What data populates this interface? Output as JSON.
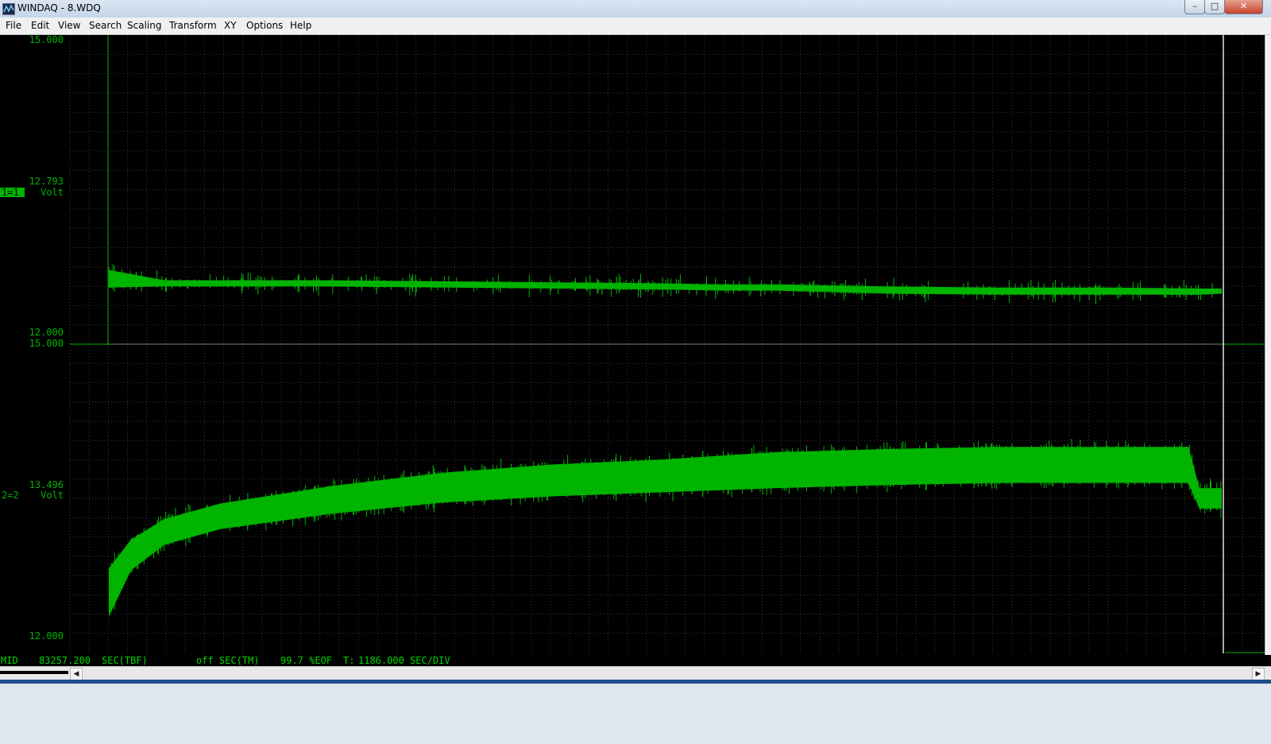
{
  "window": {
    "title": "WINDAQ - 8.WDQ",
    "controls": {
      "minimize": "–",
      "maximize": "□",
      "close": "✕"
    }
  },
  "menu": [
    "File",
    "Edit",
    "View",
    "Search",
    "Scaling",
    "Transform",
    "XY",
    "Options",
    "Help"
  ],
  "channels": [
    {
      "tag": "1=1",
      "unit": "Volt",
      "top_label": "15.000",
      "mid_label": "12.793",
      "bottom_label": "12.000",
      "tag_highlight": true
    },
    {
      "tag": "2=2",
      "unit": "Volt",
      "top_label": "15.000",
      "mid_label": "13.496",
      "bottom_label": "12.000",
      "tag_highlight": false
    }
  ],
  "status": {
    "mode": "MID",
    "time_value": "83257.200",
    "time_unit": "SEC(TBF)",
    "marker": "off SEC(TM)",
    "eof": "99.7 %EOF",
    "scale_label": "T:",
    "scale_value": "1186.000 SEC/DIV"
  },
  "colors": {
    "trace": "#00b400",
    "grid": "#3a3a3a",
    "label": "#00b400",
    "status_text": "#00d800"
  },
  "chart_data": [
    {
      "type": "line",
      "series": [
        {
          "channel": "1=1",
          "x": [
            0.0,
            0.05,
            0.1,
            0.2,
            0.3,
            0.4,
            0.5,
            0.55,
            0.6,
            0.7,
            0.8,
            0.9,
            0.98,
            1.0
          ],
          "y_upper": [
            12.72,
            12.62,
            12.62,
            12.62,
            12.61,
            12.6,
            12.59,
            12.58,
            12.58,
            12.56,
            12.55,
            12.55,
            12.54,
            12.54
          ],
          "y_lower": [
            12.55,
            12.56,
            12.56,
            12.56,
            12.55,
            12.54,
            12.53,
            12.52,
            12.52,
            12.49,
            12.48,
            12.48,
            12.48,
            12.49
          ]
        }
      ],
      "ylim": [
        12.0,
        15.0
      ],
      "ytick_labels": [
        "12.000",
        "12.793",
        "15.000"
      ],
      "ylabel": "Volt",
      "grid": true
    },
    {
      "type": "line",
      "series": [
        {
          "channel": "2=2",
          "x": [
            0.0,
            0.02,
            0.05,
            0.1,
            0.2,
            0.3,
            0.4,
            0.5,
            0.6,
            0.7,
            0.8,
            0.9,
            0.97,
            0.98,
            1.0
          ],
          "y_upper": [
            12.82,
            13.1,
            13.3,
            13.45,
            13.62,
            13.75,
            13.83,
            13.88,
            13.95,
            13.98,
            14.0,
            14.0,
            14.0,
            13.6,
            13.6
          ],
          "y_lower": [
            12.35,
            12.8,
            13.05,
            13.2,
            13.35,
            13.46,
            13.52,
            13.56,
            13.6,
            13.63,
            13.65,
            13.65,
            13.65,
            13.4,
            13.4
          ]
        }
      ],
      "ylim": [
        12.0,
        15.0
      ],
      "ytick_labels": [
        "12.000",
        "13.496",
        "15.000"
      ],
      "ylabel": "Volt",
      "grid": true
    }
  ]
}
